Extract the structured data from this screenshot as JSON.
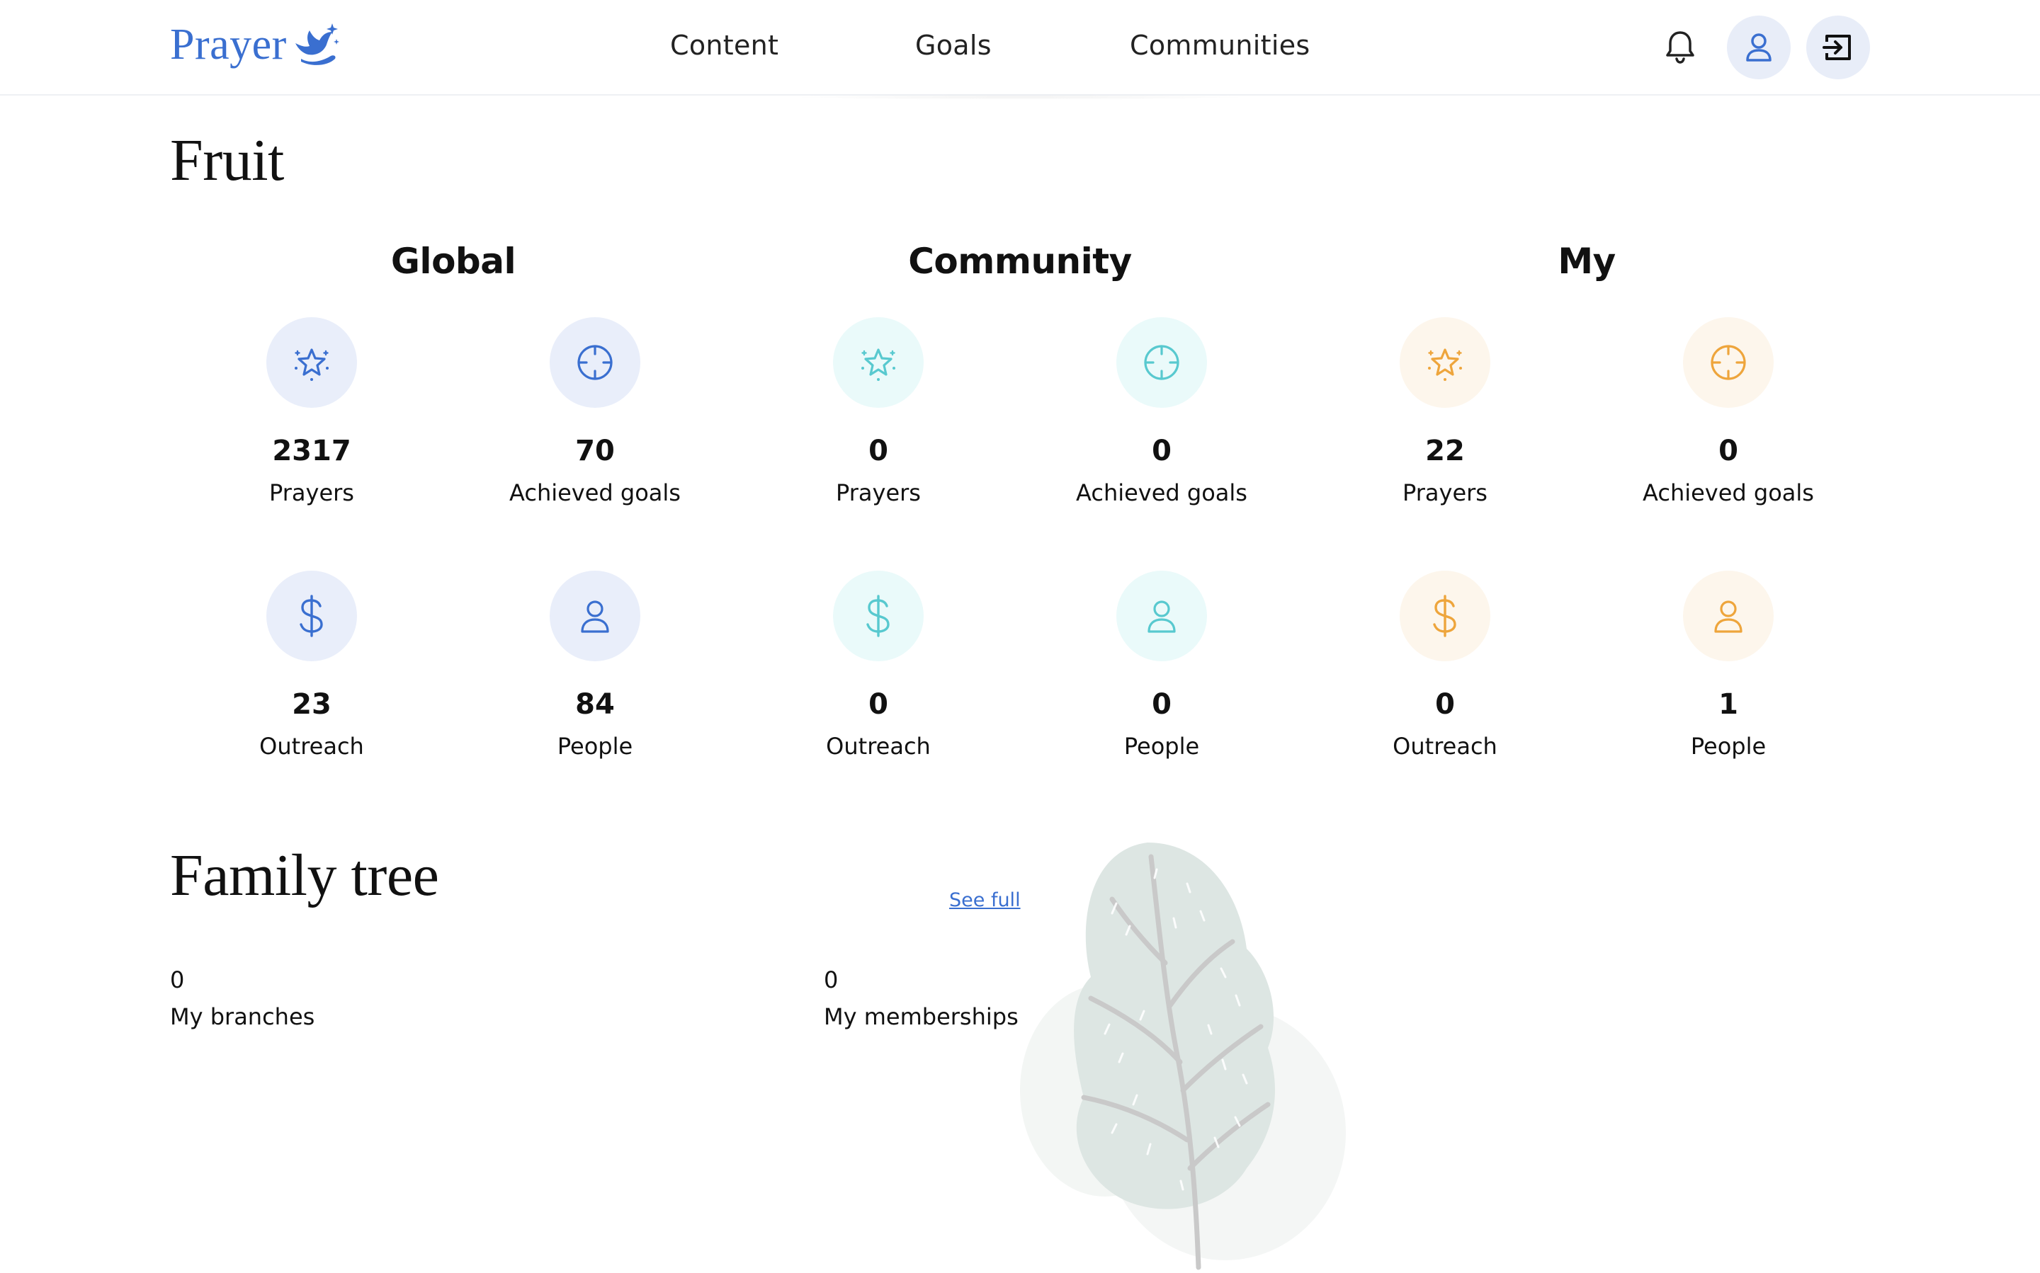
{
  "header": {
    "logo_text": "Prayer",
    "nav": [
      "Content",
      "Goals",
      "Communities"
    ],
    "icons": {
      "notifications": "bell-icon",
      "profile": "user-icon",
      "logout": "logout-icon"
    }
  },
  "fruit": {
    "title": "Fruit",
    "columns": [
      {
        "title": "Global",
        "accent": "#3a6fd0",
        "stats": [
          {
            "value": "2317",
            "label": "Prayers",
            "icon": "star-icon"
          },
          {
            "value": "70",
            "label": "Achieved goals",
            "icon": "target-icon"
          },
          {
            "value": "23",
            "label": "Outreach",
            "icon": "dollar-icon"
          },
          {
            "value": "84",
            "label": "People",
            "icon": "person-icon"
          }
        ]
      },
      {
        "title": "Community",
        "accent": "#58c9cf",
        "stats": [
          {
            "value": "0",
            "label": "Prayers",
            "icon": "star-icon"
          },
          {
            "value": "0",
            "label": "Achieved goals",
            "icon": "target-icon"
          },
          {
            "value": "0",
            "label": "Outreach",
            "icon": "dollar-icon"
          },
          {
            "value": "0",
            "label": "People",
            "icon": "person-icon"
          }
        ]
      },
      {
        "title": "My",
        "accent": "#eea53c",
        "stats": [
          {
            "value": "22",
            "label": "Prayers",
            "icon": "star-icon"
          },
          {
            "value": "0",
            "label": "Achieved goals",
            "icon": "target-icon"
          },
          {
            "value": "0",
            "label": "Outreach",
            "icon": "dollar-icon"
          },
          {
            "value": "1",
            "label": "People",
            "icon": "person-icon"
          }
        ]
      }
    ]
  },
  "family_tree": {
    "title": "Family tree",
    "see_full": "See full",
    "branches": {
      "value": "0",
      "label": "My branches"
    },
    "memberships": {
      "value": "0",
      "label": "My memberships"
    }
  }
}
